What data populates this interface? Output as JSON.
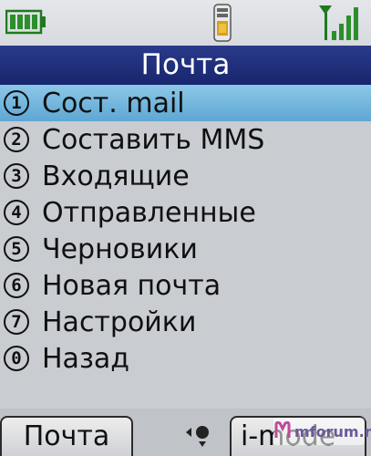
{
  "status_bar": {
    "battery_icon": "battery-icon",
    "center_icon": "phone-memory-icon",
    "signal_icon": "signal-strength-icon"
  },
  "title": "Почта",
  "menu": {
    "items": [
      {
        "num": "1",
        "label": "Сост. mail",
        "selected": true
      },
      {
        "num": "2",
        "label": "Составить MMS"
      },
      {
        "num": "3",
        "label": "Входящие"
      },
      {
        "num": "4",
        "label": "Отправленные"
      },
      {
        "num": "5",
        "label": "Черновики"
      },
      {
        "num": "6",
        "label": "Новая почта"
      },
      {
        "num": "7",
        "label": "Настройки"
      },
      {
        "num": "0",
        "label": "Назад"
      }
    ]
  },
  "softkeys": {
    "left": "Почта",
    "right": "i-mode"
  },
  "watermark": "mforum.ru",
  "colors": {
    "title_bar": "#1e2c7a",
    "selection": "#6fb4dc",
    "battery": "#2c8f2c",
    "signal": "#2c8f2c"
  }
}
